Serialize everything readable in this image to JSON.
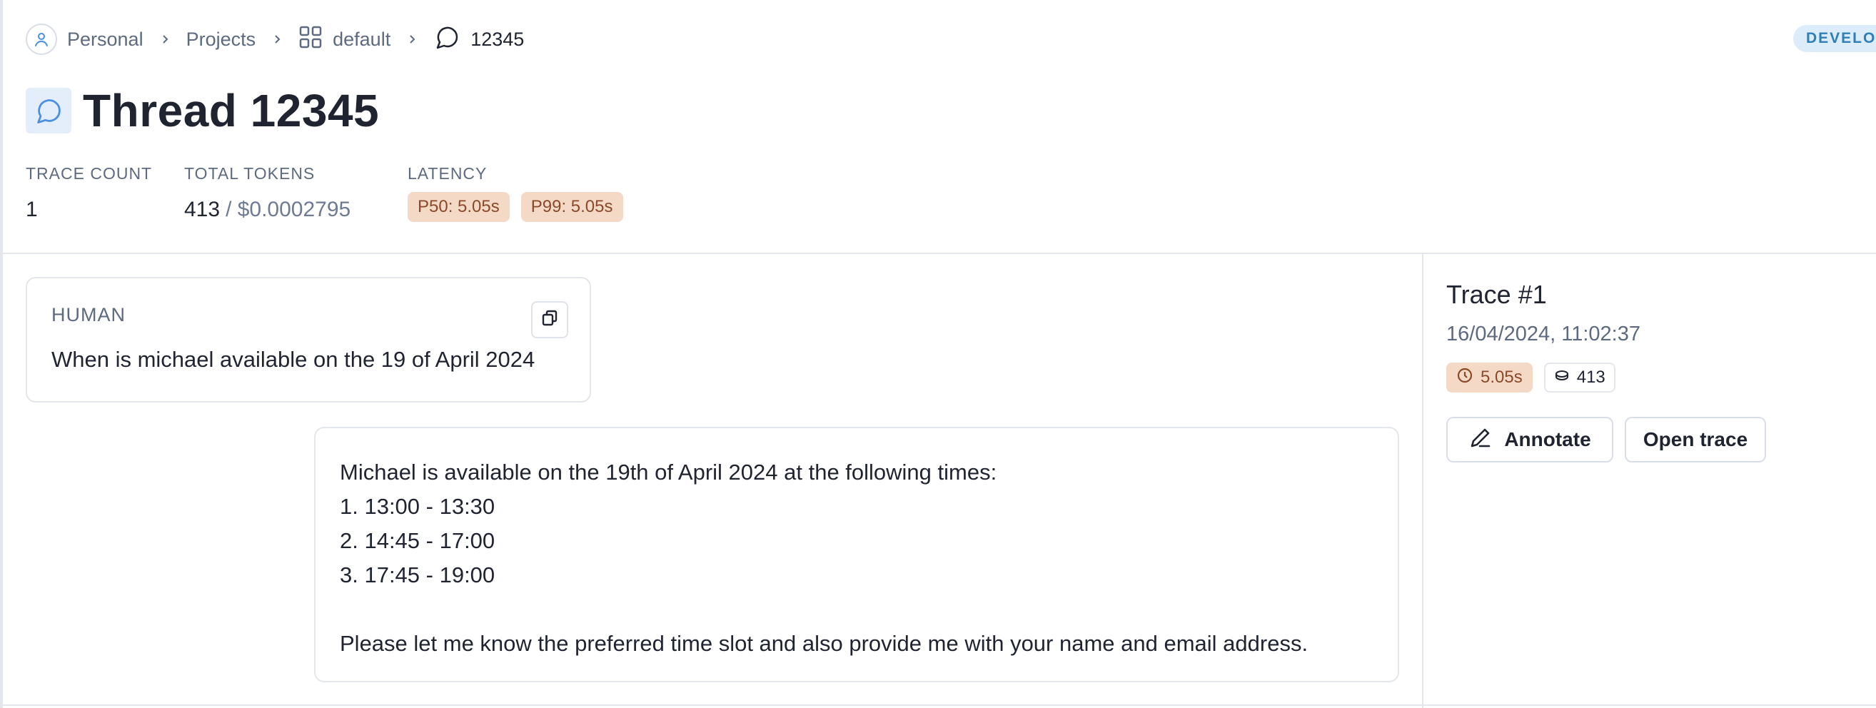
{
  "breadcrumb": {
    "personal": "Personal",
    "projects": "Projects",
    "project": "default",
    "thread": "12345"
  },
  "env_badge": "DEVELOP",
  "page": {
    "title": "Thread 12345"
  },
  "stats": {
    "trace_count_label": "TRACE COUNT",
    "trace_count_value": "1",
    "total_tokens_label": "TOTAL TOKENS",
    "total_tokens_value": "413",
    "total_tokens_cost": "/ $0.0002795",
    "latency_label": "LATENCY",
    "p50": "P50: 5.05s",
    "p99": "P99: 5.05s"
  },
  "messages": {
    "human_role": "HUMAN",
    "human_text": "When is michael available on the 19 of April 2024",
    "ai_lines": [
      "Michael is available on the 19th of April 2024 at the following times:",
      "1. 13:00 - 13:30",
      "2. 14:45 - 17:00",
      "3. 17:45 - 19:00",
      "Please let me know the preferred time slot and also provide me with your name and email address."
    ]
  },
  "trace": {
    "title": "Trace #1",
    "date": "16/04/2024, 11:02:37",
    "duration": "5.05s",
    "tokens": "413",
    "annotate_label": "Annotate",
    "open_label": "Open trace"
  },
  "colors": {
    "accent_blue": "#4a8fe0",
    "latency_badge_bg": "#f3d9c6",
    "latency_badge_text": "#8a4a2a",
    "env_badge_bg": "#dcecf8",
    "env_badge_text": "#2f7fb7"
  },
  "icons": {
    "personal": "user-icon",
    "project": "grid-icon",
    "thread": "chat-bubble-icon",
    "copy": "copy-icon",
    "duration": "clock-icon",
    "tokens": "coins-icon",
    "annotate": "pencil-icon"
  }
}
